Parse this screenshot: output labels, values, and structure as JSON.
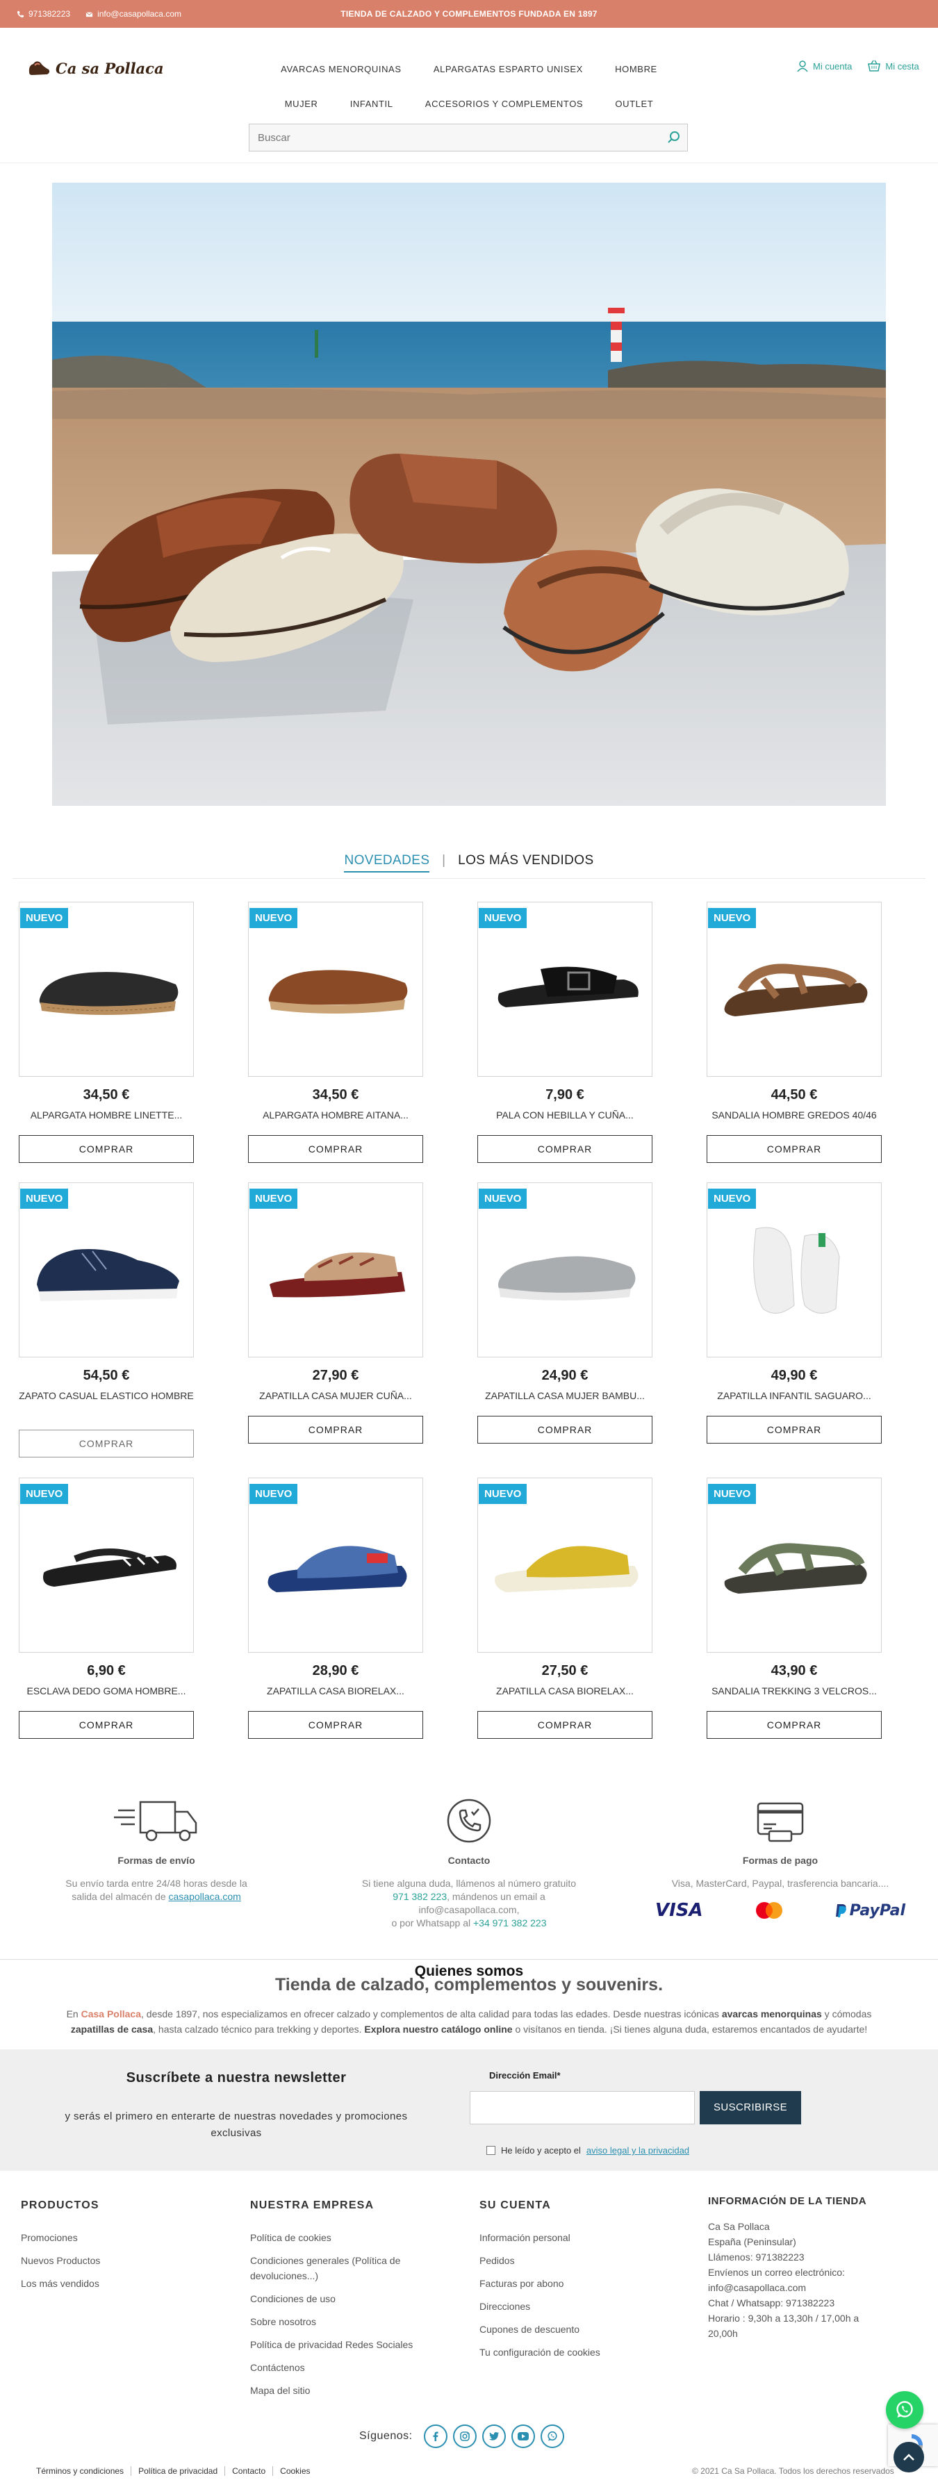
{
  "topbar": {
    "phone": "971382223",
    "email": "info@casapollaca.com",
    "tagline": "TIENDA DE CALZADO Y COMPLEMENTOS FUNDADA EN 1897"
  },
  "header": {
    "logo_text": "Ca sa Pollaca",
    "nav_row1": [
      "AVARCAS MENORQUINAS",
      "ALPARGATAS ESPARTO UNISEX",
      "HOMBRE"
    ],
    "nav_row2": [
      "MUJER",
      "INFANTIL",
      "ACCESORIOS Y COMPLEMENTOS",
      "OUTLET"
    ],
    "account_label": "Mi cuenta",
    "cart_label": "Mi cesta",
    "search_placeholder": "Buscar"
  },
  "tabs": {
    "active": "NOVEDADES",
    "separator": "|",
    "other": "LOS MÁS VENDIDOS"
  },
  "products": [
    {
      "badge": "NUEVO",
      "price": "34,50 €",
      "name": "ALPARGATA HOMBRE LINETTE...",
      "buy": "COMPRAR",
      "icon": "black-espadrille"
    },
    {
      "badge": "NUEVO",
      "price": "34,50 €",
      "name": "ALPARGATA HOMBRE AITANA...",
      "buy": "COMPRAR",
      "icon": "brown-espadrille"
    },
    {
      "badge": "NUEVO",
      "price": "7,90 €",
      "name": "PALA CON HEBILLA Y CUÑA...",
      "buy": "COMPRAR",
      "icon": "black-wedge-slide"
    },
    {
      "badge": "NUEVO",
      "price": "44,50 €",
      "name": "SANDALIA HOMBRE GREDOS 40/46",
      "buy": "COMPRAR",
      "icon": "brown-sandal"
    },
    {
      "badge": "NUEVO",
      "price": "54,50 €",
      "name": "ZAPATO CASUAL ELASTICO HOMBRE",
      "buy": "COMPRAR",
      "icon": "navy-sneaker"
    },
    {
      "badge": "NUEVO",
      "price": "27,90 €",
      "name": "ZAPATILLA CASA MUJER CUÑA...",
      "buy": "COMPRAR",
      "icon": "patterned-slipper"
    },
    {
      "badge": "NUEVO",
      "price": "24,90 €",
      "name": "ZAPATILLA CASA MUJER BAMBU...",
      "buy": "COMPRAR",
      "icon": "grey-slipper"
    },
    {
      "badge": "NUEVO",
      "price": "49,90 €",
      "name": "ZAPATILLA INFANTIL SAGUARO...",
      "buy": "COMPRAR",
      "icon": "white-kids-shoe"
    },
    {
      "badge": "NUEVO",
      "price": "6,90 €",
      "name": "ESCLAVA DEDO GOMA HOMBRE...",
      "buy": "COMPRAR",
      "icon": "black-flipflop"
    },
    {
      "badge": "NUEVO",
      "price": "28,90 €",
      "name": "ZAPATILLA CASA BIORELAX...",
      "buy": "COMPRAR",
      "icon": "blue-slipper"
    },
    {
      "badge": "NUEVO",
      "price": "27,50 €",
      "name": "ZAPATILLA CASA BIORELAX...",
      "buy": "COMPRAR",
      "icon": "yellow-slipper"
    },
    {
      "badge": "NUEVO",
      "price": "43,90 €",
      "name": "SANDALIA TREKKING 3 VELCROS...",
      "buy": "COMPRAR",
      "icon": "green-sandal"
    }
  ],
  "info": {
    "shipping": {
      "title": "Formas de envío",
      "line1": "Su envío tarda entre 24/48 horas desde la",
      "line2": "salida del almacén de",
      "link": "casapollaca.com"
    },
    "contact": {
      "title": "Contacto",
      "line1": "Si tiene alguna duda, llámenos al número gratuito",
      "phone1": "971 382 223",
      "line2": ", mándenos un email a info@casapollaca.com,",
      "line3": "o por Whatsapp al",
      "phone2": "+34 971 382 223"
    },
    "payment": {
      "title": "Formas de pago",
      "desc": "Visa, MasterCard, Paypal, trasferencia bancaria....",
      "visa": "VISA",
      "paypal": "PayPal"
    }
  },
  "about": {
    "heading": "Quienes somos",
    "subheading": "Tienda de calzado, complementos y souvenirs.",
    "p1_a": "En ",
    "brand": "Casa Pollaca",
    "p1_b": ", desde 1897, nos especializamos en ofrecer calzado y complementos de alta calidad para todas las edades. Desde nuestras icónicas ",
    "bold1": "avarcas menorquinas",
    "p1_c": " y cómodas",
    "bold2": "zapatillas de casa",
    "p2_a": ", hasta calzado técnico para trekking y deportes. ",
    "bold3": "Explora nuestro catálogo online",
    "p2_b": " o visítanos en tienda. ¡Si tienes alguna duda, estaremos encantados de ayudarte!"
  },
  "newsletter": {
    "title": "Suscríbete a nuestra newsletter",
    "subtitle1": "y serás el primero en enterarte de nuestras novedades y promociones",
    "subtitle2": "exclusivas",
    "email_label": "Dirección Email*",
    "button": "SUSCRIBIRSE",
    "consent": "He leído y acepto el",
    "consent_link": "aviso legal y la privacidad"
  },
  "footer": {
    "productos": {
      "title": "PRODUCTOS",
      "items": [
        "Promociones",
        "Nuevos Productos",
        "Los más vendidos"
      ]
    },
    "empresa": {
      "title": "NUESTRA EMPRESA",
      "items": [
        "Política de cookies",
        "Condiciones generales (Política de devoluciones...)",
        "Condiciones de uso",
        "Sobre nosotros",
        "Política de privacidad Redes Sociales",
        "Contáctenos",
        "Mapa del sitio"
      ]
    },
    "cuenta": {
      "title": "SU CUENTA",
      "items": [
        "Información personal",
        "Pedidos",
        "Facturas por abono",
        "Direcciones",
        "Cupones de descuento",
        "Tu configuración de cookies"
      ]
    },
    "store": {
      "title": "INFORMACIÓN DE LA TIENDA",
      "lines": [
        "Ca Sa Pollaca",
        "España (Peninsular)",
        "Llámenos: 971382223",
        "Envíenos un correo electrónico:",
        "info@casapollaca.com",
        "Chat / Whatsapp: 971382223",
        "Horario : 9,30h a 13,30h / 17,00h a",
        "20,00h"
      ]
    },
    "follow": "Síguenos:",
    "legal": [
      "Términos y condiciones",
      "Política de privacidad",
      "Contacto",
      "Cookies"
    ],
    "copyright": "© 2021 Ca Sa Pollaca. Todos los derechos reservados"
  },
  "colors": {
    "topbar": "#d9806a",
    "accent_teal": "#2aa198",
    "badge_blue": "#21a9d8",
    "tab_active": "#2a8fb0",
    "button_dark": "#1f3b4d"
  }
}
